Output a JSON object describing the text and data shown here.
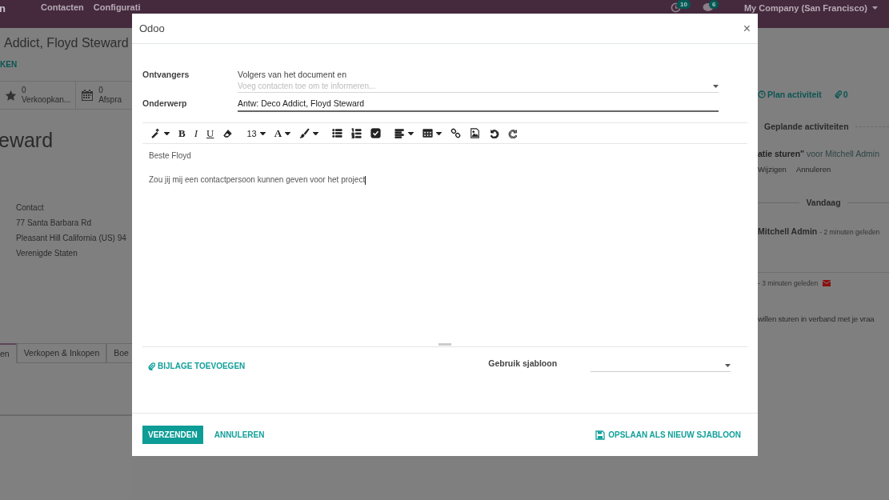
{
  "navbar": {
    "brand": "n",
    "menus": [
      "Contacten",
      "Configurati"
    ],
    "activity_count": "10",
    "message_count": "6",
    "company": "My Company (San Francisco)"
  },
  "form": {
    "breadcrumb": "Addict, Floyd Steward",
    "action": "KEN",
    "stat_buttons": [
      {
        "kind": "star",
        "value": "0",
        "label": "Verkoopkan..."
      },
      {
        "kind": "calendar",
        "value": "0",
        "label": "Afspra"
      }
    ],
    "name": "eward",
    "address": [
      "Contact",
      "77 Santa Barbara Rd",
      "Pleasant Hill  California (US)  94",
      "Verenigde Staten"
    ],
    "tabs": [
      {
        "label": "en",
        "selected": true
      },
      {
        "label": "Verkopen & Inkopen",
        "selected": false
      },
      {
        "label": "Boe",
        "selected": false
      }
    ]
  },
  "chatter": {
    "plan_activity": "Plan activiteit",
    "attachments": "0",
    "planned_heading": "Geplande activiteiten",
    "activity": {
      "title": "atie sturen\"",
      "assignee": "voor Mitchell Admin"
    },
    "activity_actions": [
      "Wijzigen",
      "Annuleren"
    ],
    "date_separator": "Vandaag",
    "messages": [
      {
        "author": "Mitchell Admin",
        "time": "- 2 minuten geleden"
      },
      {
        "time": "- 3 minuten geleden",
        "body": "willen sturen in verband met je vraa"
      }
    ]
  },
  "dialog": {
    "title": "Odoo",
    "close": "×",
    "recipients": {
      "label": "Ontvangers",
      "value": "Volgers van het document en",
      "placeholder": "Voeg contacten toe om te informeren..."
    },
    "subject": {
      "label": "Onderwerp",
      "value": "Antw: Deco Addict, Floyd Steward"
    },
    "toolbar": [
      {
        "kind": "magic",
        "menu": true
      },
      {
        "kind": "bold",
        "label": "B"
      },
      {
        "kind": "italic",
        "label": "I"
      },
      {
        "kind": "underline",
        "label": "U"
      },
      {
        "kind": "eraser"
      },
      {
        "kind": "size",
        "label": "13",
        "menu": true
      },
      {
        "kind": "color",
        "label": "A",
        "menu": true
      },
      {
        "kind": "brush",
        "menu": true
      },
      {
        "kind": "ul"
      },
      {
        "kind": "ol"
      },
      {
        "kind": "checklist"
      },
      {
        "kind": "align",
        "menu": true
      },
      {
        "kind": "table",
        "menu": true
      },
      {
        "kind": "link"
      },
      {
        "kind": "image"
      },
      {
        "kind": "undo"
      },
      {
        "kind": "redo"
      }
    ],
    "body": [
      "Beste Floyd",
      "Zou jij mij een contactpersoon kunnen geven voor het project"
    ],
    "attach": "BIJLAGE TOEVOEGEN",
    "template": {
      "label": "Gebruik sjabloon"
    },
    "buttons": [
      {
        "kind": "primary",
        "label": "VERZENDEN"
      },
      {
        "kind": "link",
        "label": "ANNULEREN"
      },
      {
        "kind": "save",
        "label": "OPSLAAN ALS NIEUW SJABLOON"
      }
    ]
  }
}
